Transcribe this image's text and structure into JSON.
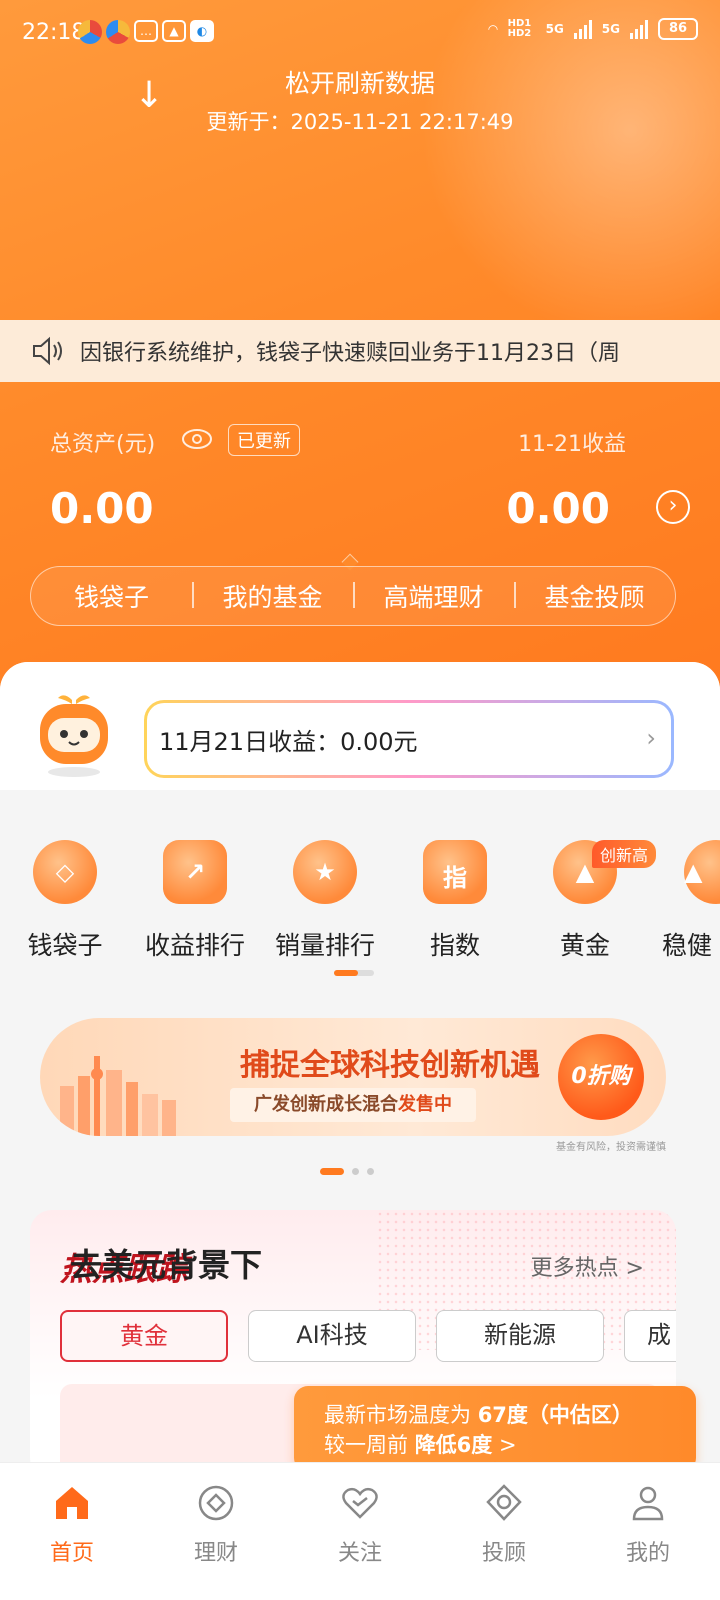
{
  "status_bar": {
    "time": "22:18",
    "network_1": "5G",
    "network_2": "5G",
    "hd": "HD1 HD2",
    "battery": "86"
  },
  "refresh": {
    "title": "松开刷新数据",
    "updated": "更新于：2025-11-21 22:17:49"
  },
  "notice": {
    "text": "因银行系统维护，钱袋子快速赎回业务于11月23日（周"
  },
  "assets": {
    "label": "总资产(元)",
    "badge": "已更新",
    "value": "0.00",
    "income_label": "11-21收益",
    "income_value": "0.00"
  },
  "segments": [
    "钱袋子",
    "我的基金",
    "高端理财",
    "基金投顾"
  ],
  "daily_income": {
    "text": "11月21日收益：0.00元"
  },
  "quick_entries": [
    {
      "label": "钱袋子",
      "icon": "money-bag-icon",
      "glyph": "◇"
    },
    {
      "label": "收益排行",
      "icon": "trend-bag-icon",
      "glyph": "↗"
    },
    {
      "label": "销量排行",
      "icon": "medal-icon",
      "glyph": "★"
    },
    {
      "label": "指数",
      "icon": "index-icon",
      "glyph": "指"
    },
    {
      "label": "黄金",
      "icon": "gold-icon",
      "glyph": "▲"
    },
    {
      "label": "稳健",
      "icon": "steady-icon",
      "glyph": "▲"
    }
  ],
  "gold_badge": "创新高",
  "banner": {
    "title": "捕捉全球科技创新机遇",
    "subtitle_prefix": "广发创新成长混合",
    "subtitle_highlight": "发售中",
    "button": "0折购",
    "risk": "基金有风险，投资需谨慎"
  },
  "hot_topics": {
    "title": "热点跟踪",
    "more": "更多热点 >",
    "chips": [
      "黄金",
      "AI科技",
      "新能源",
      "成"
    ],
    "article_title": "去美元背景下"
  },
  "market_tip": {
    "line1_prefix": "最新市场温度为 ",
    "line1_value": "67度（中估区）",
    "line2_prefix": "较一周前 ",
    "line2_value": "降低6度",
    "line2_suffix": " >"
  },
  "tabbar": [
    {
      "label": "首页",
      "icon": "home-icon",
      "active": true
    },
    {
      "label": "理财",
      "icon": "wealth-icon",
      "active": false
    },
    {
      "label": "关注",
      "icon": "heart-icon",
      "active": false
    },
    {
      "label": "投顾",
      "icon": "advisor-icon",
      "active": false
    },
    {
      "label": "我的",
      "icon": "profile-icon",
      "active": false
    }
  ],
  "colors": {
    "brand": "#ff7a1f",
    "hot_red": "#e0303a"
  }
}
